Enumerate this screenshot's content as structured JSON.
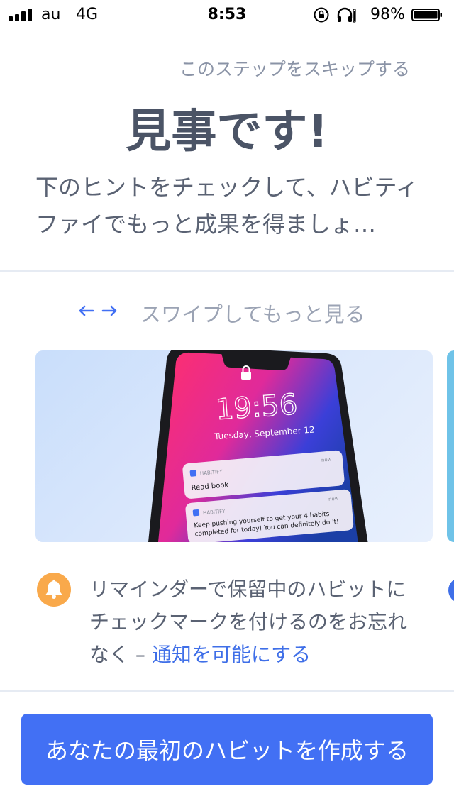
{
  "status_bar": {
    "carrier": "au",
    "network": "4G",
    "time": "8:53",
    "battery_percent": "98%",
    "icons": [
      "signal-icon",
      "orientation-lock-icon",
      "headphones-icon",
      "battery-icon"
    ]
  },
  "header": {
    "skip_label": "このステップをスキップする",
    "title": "見事です!",
    "subtitle": "下のヒントをチェックして、ハビティファイでもっと成果を得ましょ…"
  },
  "swipe_hint": {
    "icon": "swipe-arrows-icon",
    "label": "スワイプしてもっと見る"
  },
  "tip_card": {
    "image": {
      "lock_time": "19:56",
      "lock_date": "Tuesday, September 12",
      "notifications": [
        {
          "app": "HABITIFY",
          "when": "now",
          "text": "Read book"
        },
        {
          "app": "HABITIFY",
          "when": "now",
          "text_line1": "Keep pushing yourself to get your 4 habits",
          "text_line2": "completed for today! You can definitely do it!"
        }
      ]
    },
    "icon": "bell-icon",
    "text": "リマインダーで保留中のハビットにチェックマークを付けるのをお忘れなく – ",
    "link_label": "通知を可能にする"
  },
  "cta": {
    "label": "あなたの最初のハビットを作成する"
  },
  "colors": {
    "accent": "#4270f4",
    "link": "#3f6fe8",
    "bell": "#f9a94b",
    "text": "#4b5466",
    "muted": "#8a93a6"
  }
}
